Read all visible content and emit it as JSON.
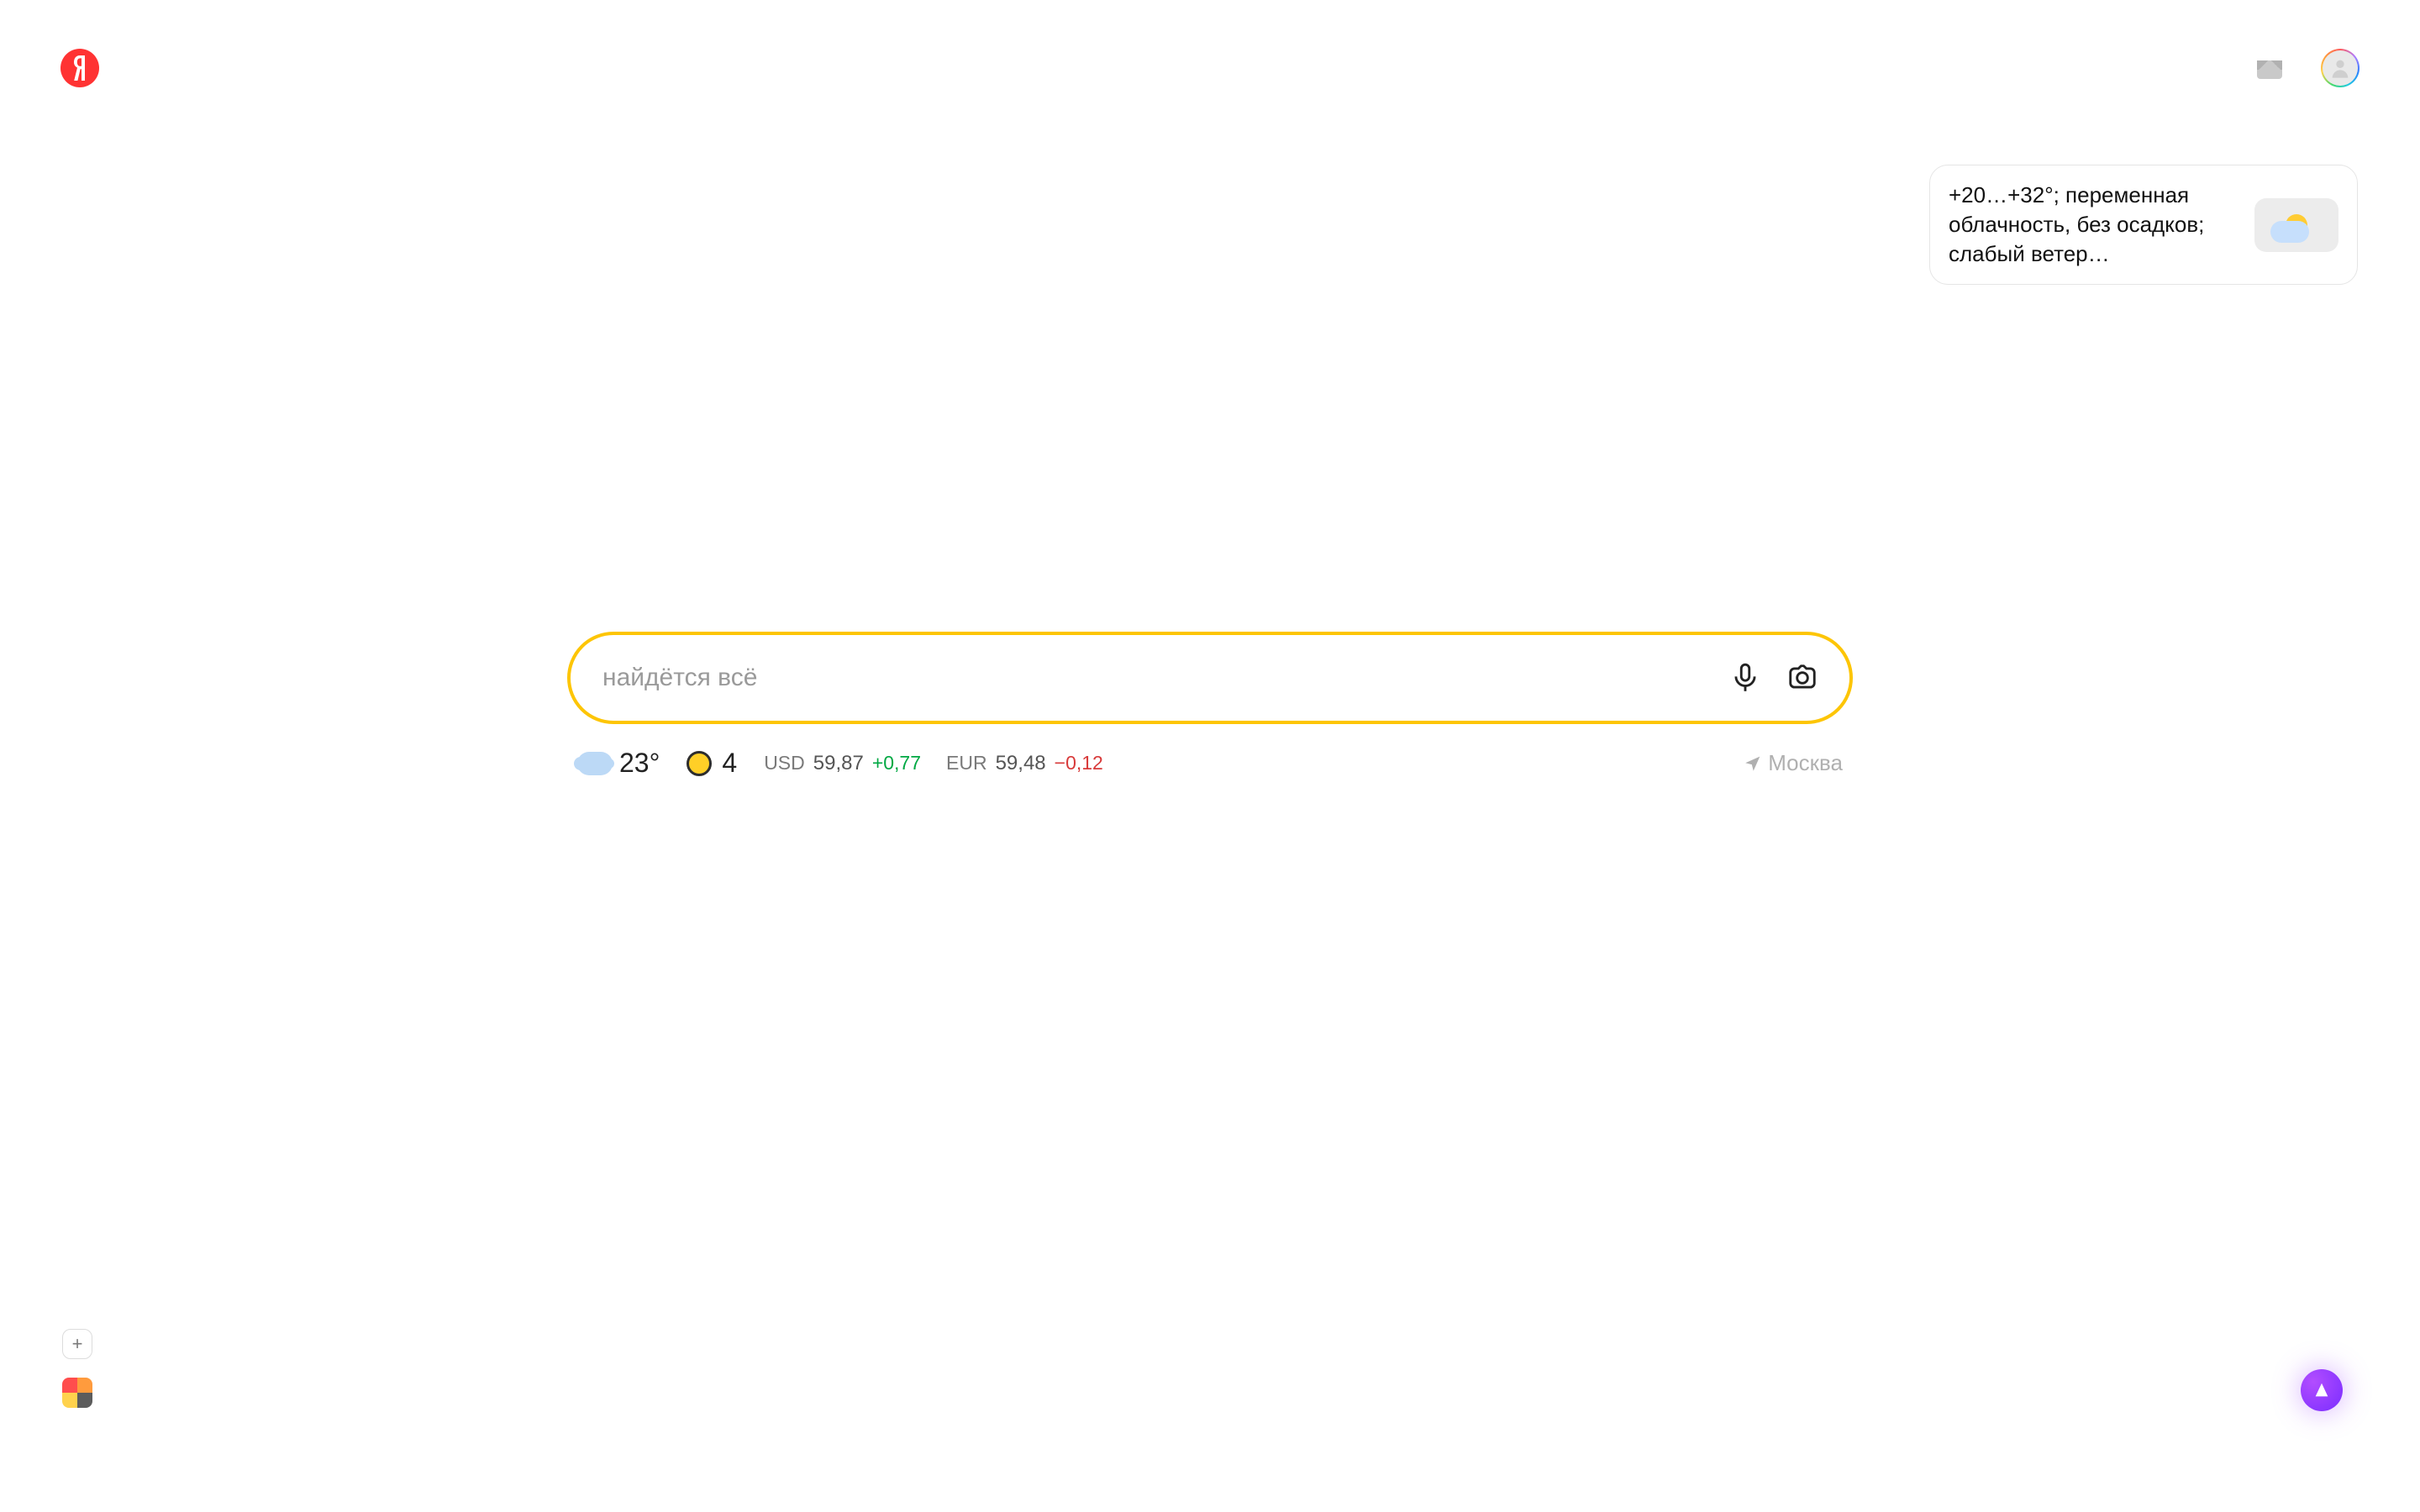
{
  "logo": {
    "letter": "Я"
  },
  "header": {
    "mail_tooltip": "Почта",
    "avatar_name": "profile-avatar"
  },
  "weather_popup": {
    "text": "+20…+32°; переменная облачность, без осадков; слабый ветер…"
  },
  "search": {
    "placeholder": "найдётся всё",
    "value": ""
  },
  "info": {
    "weather": {
      "temp": "23°"
    },
    "traffic": {
      "score": "4"
    },
    "rates": [
      {
        "code": "USD",
        "value": "59,87",
        "delta": "+0,77",
        "dir": "pos"
      },
      {
        "code": "EUR",
        "value": "59,48",
        "delta": "−0,12",
        "dir": "neg"
      }
    ],
    "location": "Москва"
  },
  "bottom": {
    "add_label": "+"
  }
}
